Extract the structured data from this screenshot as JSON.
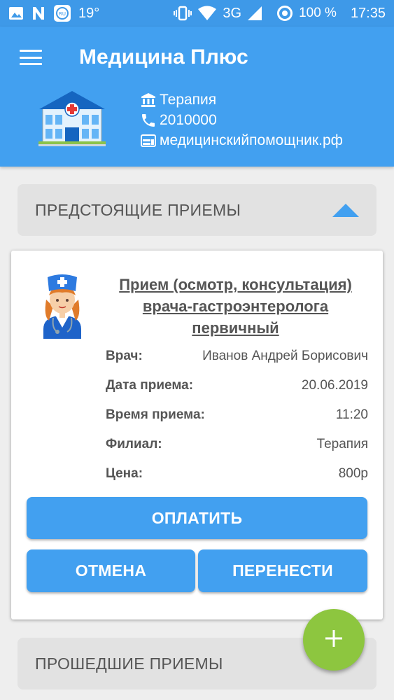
{
  "status_bar": {
    "temperature": "19°",
    "network": "3G",
    "battery": "100 %",
    "time": "17:35",
    "icons": [
      "image-icon",
      "n-app-icon",
      "ru-app-icon",
      "vibrate-icon",
      "wifi-icon",
      "signal-icon",
      "battery-saver-icon"
    ]
  },
  "header": {
    "menu_icon": "hamburger-menu-icon",
    "title": "Медицина Плюс",
    "clinic": {
      "department": "Терапия",
      "phone": "2010000",
      "website": "медицинскийпомощник.рф"
    }
  },
  "upcoming": {
    "label": "ПРЕДСТОЯЩИЕ ПРИЕМЫ",
    "expanded": true
  },
  "appointment": {
    "service": "Прием (осмотр, консультация) врача-гастроэнтеролога первичный",
    "rows": [
      {
        "label": "Врач:",
        "value": "Иванов Андрей Борисович"
      },
      {
        "label": "Дата приема:",
        "value": "20.06.2019"
      },
      {
        "label": "Время приема:",
        "value": "11:20"
      },
      {
        "label": "Филиал:",
        "value": "Терапия"
      },
      {
        "label": "Цена:",
        "value": "800р"
      }
    ],
    "pay_label": "ОПЛАТИТЬ",
    "cancel_label": "ОТМЕНА",
    "reschedule_label": "ПЕРЕНЕСТИ"
  },
  "past": {
    "label": "ПРОШЕДШИЕ ПРИЕМЫ"
  },
  "colors": {
    "primary": "#42a0f0",
    "status_bar": "#3e99e8",
    "fab": "#8dc63f"
  }
}
